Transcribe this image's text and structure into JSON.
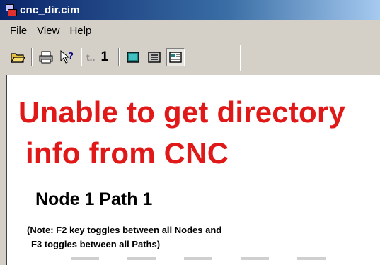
{
  "window": {
    "title": "cnc_dir.cim"
  },
  "menu": [
    {
      "label": "File"
    },
    {
      "label": "View"
    },
    {
      "label": "Help"
    }
  ],
  "toolbar": {
    "up_label": "t..",
    "level_value": "1"
  },
  "content": {
    "error_line1": "Unable to get directory",
    "error_line2": "info from CNC",
    "node_path": "Node 1  Path 1",
    "note_line1": "(Note: F2 key toggles between all Nodes and",
    "note_line2": "F3 toggles between all Paths)"
  },
  "colors": {
    "error_text": "#e01818",
    "title_bar": "#0a246a",
    "chrome": "#d4d0c8"
  }
}
